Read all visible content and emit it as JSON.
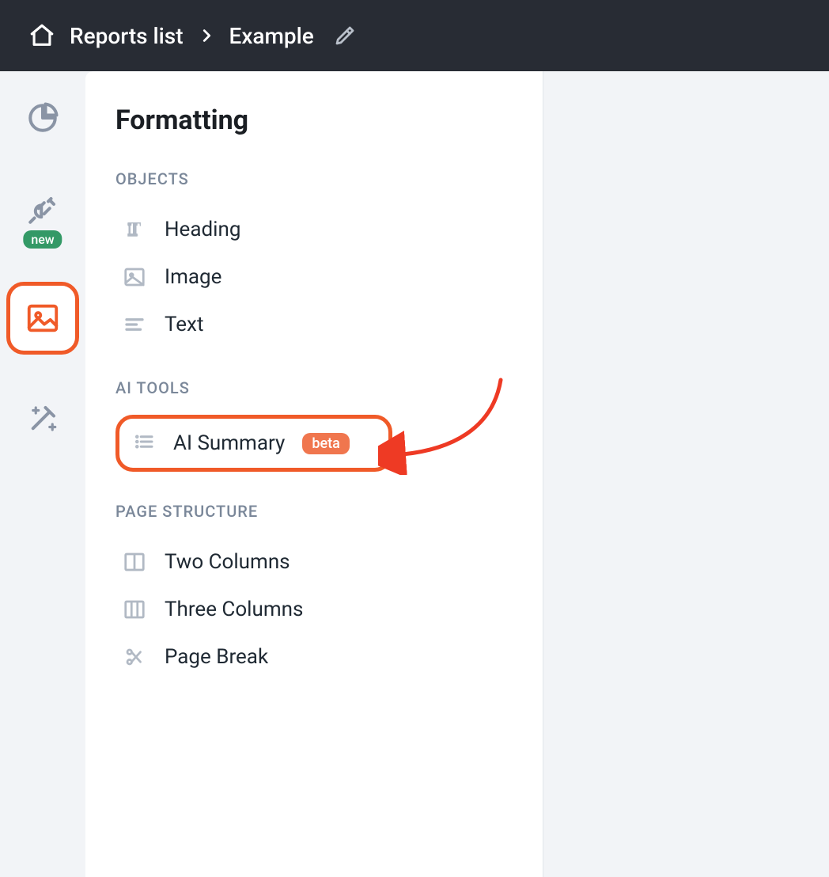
{
  "breadcrumb": {
    "root_label": "Reports list",
    "current_label": "Example"
  },
  "rail": {
    "new_badge": "new"
  },
  "panel": {
    "title": "Formatting",
    "sections": {
      "objects": {
        "label": "OBJECTS",
        "items": [
          {
            "label": "Heading"
          },
          {
            "label": "Image"
          },
          {
            "label": "Text"
          }
        ]
      },
      "ai_tools": {
        "label": "AI TOOLS",
        "items": [
          {
            "label": "AI Summary",
            "badge": "beta"
          }
        ]
      },
      "page_structure": {
        "label": "PAGE STRUCTURE",
        "items": [
          {
            "label": "Two Columns"
          },
          {
            "label": "Three Columns"
          },
          {
            "label": "Page Break"
          }
        ]
      }
    }
  }
}
